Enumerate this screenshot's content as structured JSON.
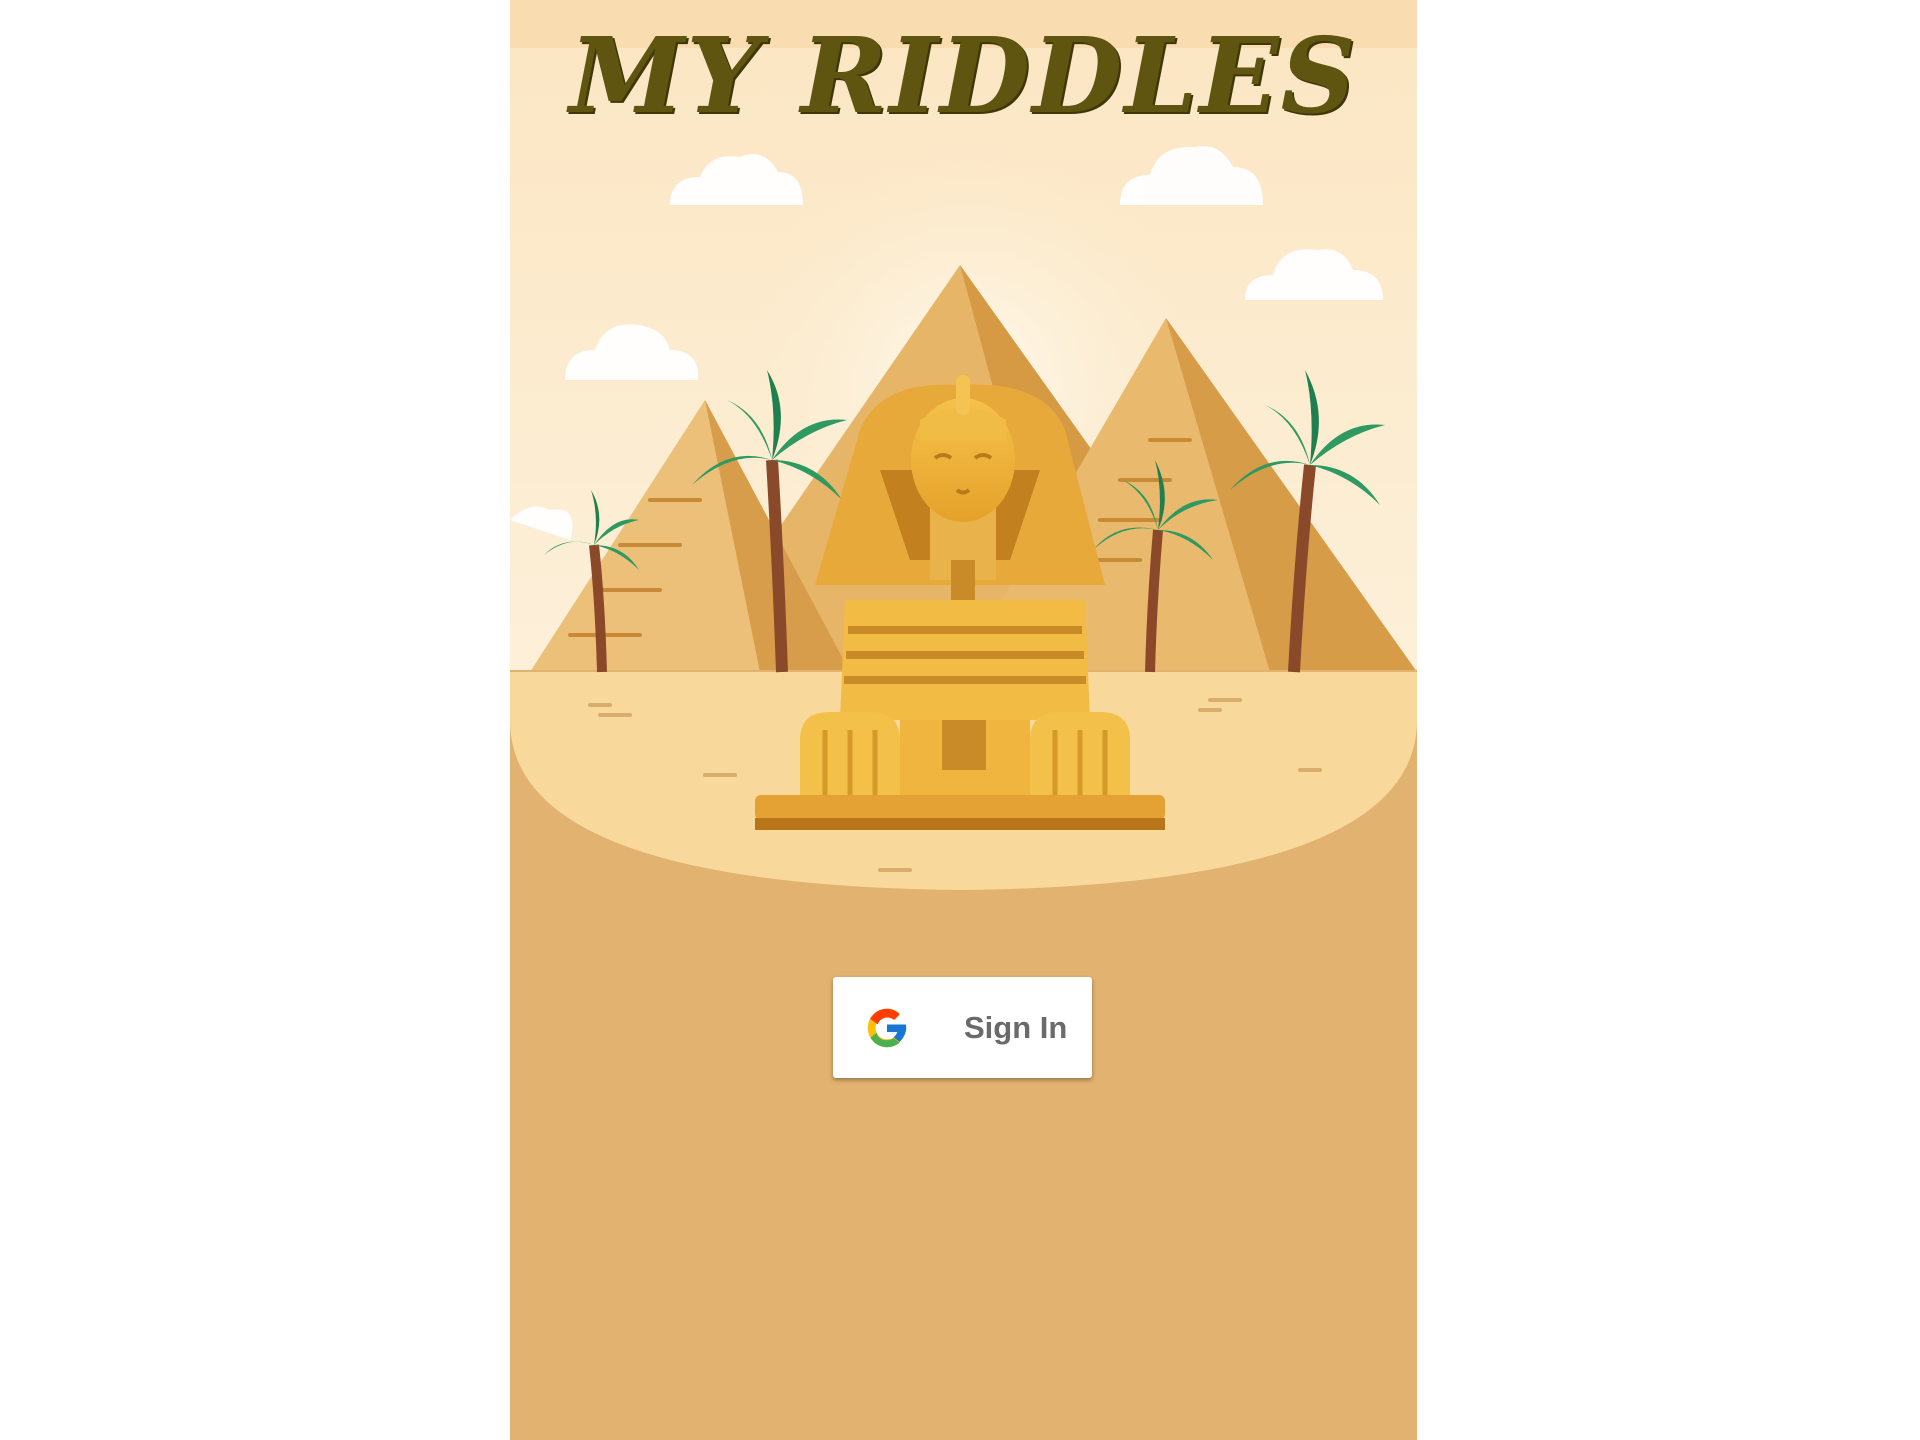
{
  "app": {
    "title": "MY RIDDLES"
  },
  "signin": {
    "label": "Sign In",
    "icon": "google-logo-icon"
  },
  "colors": {
    "ground": "#e2b270",
    "title": "#5f5410",
    "button_bg": "#ffffff"
  }
}
